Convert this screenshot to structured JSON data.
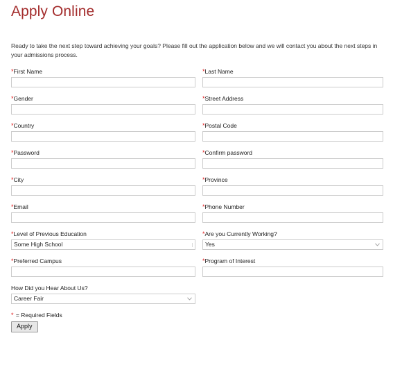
{
  "page": {
    "title": "Apply Online",
    "intro": "Ready to take the next step toward achieving your goals? Please fill out the application below and we will contact you about the next steps in your admissions process."
  },
  "colors": {
    "title": "#A32C2C",
    "required_asterisk": "#E01B1B",
    "input_border": "#cccccc",
    "text": "#222222",
    "page_background": "#ffffff",
    "button_face": "#e7e7e7",
    "button_border": "#9a9a9a"
  },
  "form": {
    "rows": [
      {
        "left": {
          "label": "First Name",
          "required": true,
          "type": "text",
          "value": "",
          "placeholder": ""
        },
        "right": {
          "label": "Last Name",
          "required": true,
          "type": "text",
          "value": "",
          "placeholder": ""
        }
      },
      {
        "left": {
          "label": "Gender",
          "required": true,
          "type": "text",
          "value": "",
          "placeholder": ""
        },
        "right": {
          "label": "Street Address",
          "required": true,
          "type": "text",
          "value": "",
          "placeholder": ""
        }
      },
      {
        "left": {
          "label": "Country",
          "required": true,
          "type": "text",
          "value": "",
          "placeholder": ""
        },
        "right": {
          "label": "Postal Code",
          "required": true,
          "type": "text",
          "value": "",
          "placeholder": ""
        }
      },
      {
        "left": {
          "label": "Password",
          "required": true,
          "type": "text",
          "value": "",
          "placeholder": ""
        },
        "right": {
          "label": "Confirm password",
          "required": true,
          "type": "text",
          "value": "",
          "placeholder": ""
        }
      },
      {
        "left": {
          "label": "City",
          "required": true,
          "type": "text",
          "value": "",
          "placeholder": ""
        },
        "right": {
          "label": "Province",
          "required": true,
          "type": "text",
          "value": "",
          "placeholder": ""
        }
      },
      {
        "left": {
          "label": "Email",
          "required": true,
          "type": "text",
          "value": "",
          "placeholder": ""
        },
        "right": {
          "label": "Phone Number",
          "required": true,
          "type": "text",
          "value": "",
          "placeholder": ""
        }
      },
      {
        "left": {
          "label": "Level of Previous Education",
          "required": true,
          "type": "select",
          "value": "Some High School"
        },
        "right": {
          "label": "Are you Currently Working?",
          "required": true,
          "type": "select",
          "value": "Yes"
        }
      },
      {
        "left": {
          "label": "Preferred Campus",
          "required": true,
          "type": "text",
          "value": "",
          "placeholder": ""
        },
        "right": {
          "label": "Program of Interest",
          "required": true,
          "type": "text",
          "value": "",
          "placeholder": ""
        }
      }
    ],
    "hear_about_us": {
      "label": "How Did you Hear About Us?",
      "required": false,
      "type": "select",
      "value": "Career Fair"
    },
    "required_note_symbol": "*",
    "required_note_text": " = Required Fields",
    "submit_label": "Apply"
  }
}
